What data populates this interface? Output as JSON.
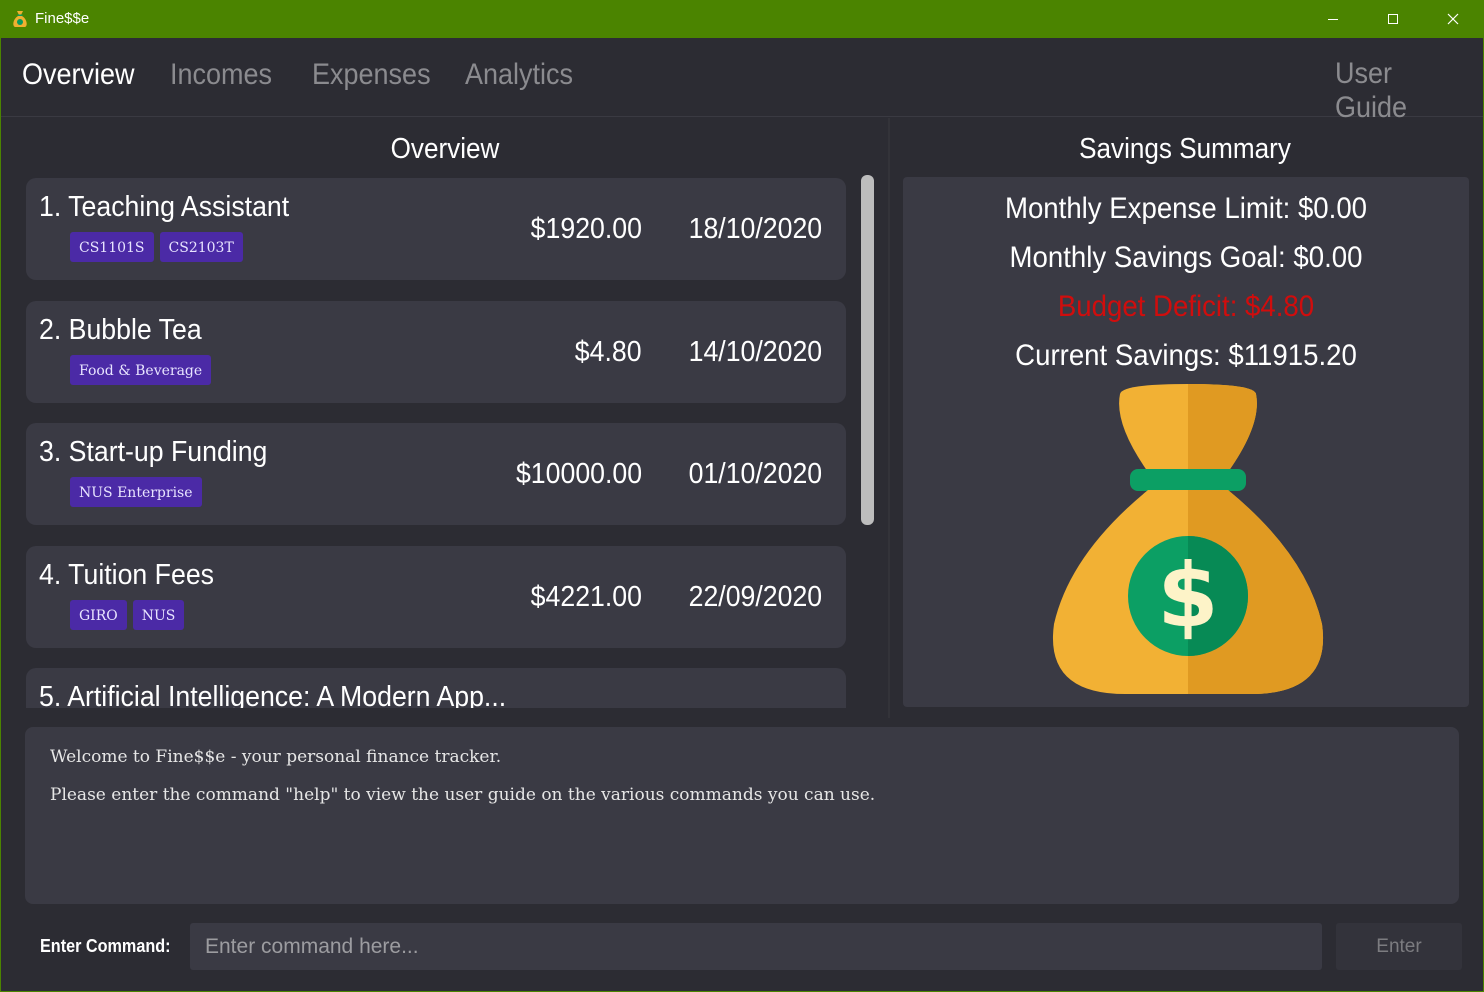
{
  "window": {
    "title": "Fine$$e"
  },
  "tabs": [
    {
      "label": "Overview",
      "active": true
    },
    {
      "label": "Incomes",
      "active": false
    },
    {
      "label": "Expenses",
      "active": false
    },
    {
      "label": "Analytics",
      "active": false
    }
  ],
  "user_guide_label": "User Guide",
  "overview": {
    "title": "Overview",
    "items": [
      {
        "name": "1. Teaching Assistant",
        "tags": [
          "CS1101S",
          "CS2103T"
        ],
        "amount": "$1920.00",
        "date": "18/10/2020"
      },
      {
        "name": "2. Bubble Tea",
        "tags": [
          "Food & Beverage"
        ],
        "amount": "$4.80",
        "date": "14/10/2020"
      },
      {
        "name": "3. Start-up Funding",
        "tags": [
          "NUS Enterprise"
        ],
        "amount": "$10000.00",
        "date": "01/10/2020"
      },
      {
        "name": "4. Tuition Fees",
        "tags": [
          "GIRO",
          "NUS"
        ],
        "amount": "$4221.00",
        "date": "22/09/2020"
      },
      {
        "name": "5. Artificial Intelligence: A Modern App...",
        "tags": [],
        "amount": "",
        "date": ""
      }
    ]
  },
  "savings": {
    "title": "Savings Summary",
    "monthly_expense_limit": "Monthly Expense Limit: $0.00",
    "monthly_savings_goal": "Monthly Savings Goal: $0.00",
    "budget_deficit": "Budget Deficit: $4.80",
    "current_savings": "Current Savings: $11915.20"
  },
  "result_display": {
    "lines": [
      "Welcome to Fine$$e - your personal finance tracker.",
      "Please enter the command \"help\" to view the user guide on the various commands you can use."
    ]
  },
  "command": {
    "label": "Enter Command:",
    "placeholder": "Enter command here...",
    "value": "",
    "button_label": "Enter"
  },
  "colors": {
    "titlebar": "#4b8400",
    "tag": "#4b2aa6",
    "deficit": "#d00d0d",
    "card": "#3a3a44",
    "background": "#2c2c33"
  }
}
